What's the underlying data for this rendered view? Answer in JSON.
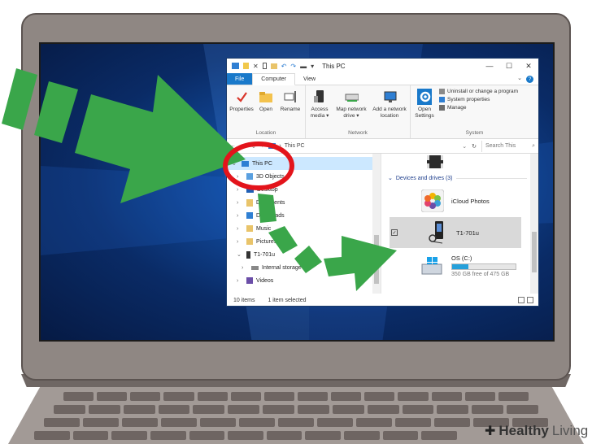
{
  "window": {
    "title": "This PC",
    "tabs": [
      "File",
      "Computer",
      "View"
    ],
    "help_glyph": "?",
    "controls": {
      "minimize": "—",
      "maximize": "☐",
      "close": "✕"
    }
  },
  "ribbon": {
    "location_group": {
      "name": "Location",
      "items": [
        "Properties",
        "Open",
        "Rename"
      ]
    },
    "network_group": {
      "name": "Network",
      "items": [
        {
          "line1": "Access",
          "line2": "media ▾"
        },
        {
          "line1": "Map network",
          "line2": "drive ▾"
        },
        {
          "line1": "Add a network",
          "line2": "location"
        }
      ]
    },
    "system_group": {
      "name": "System",
      "open_settings": {
        "line1": "Open",
        "line2": "Settings"
      },
      "small_items": [
        "Uninstall or change a program",
        "System properties",
        "Manage"
      ]
    }
  },
  "address_bar": {
    "path": "This PC",
    "search_placeholder": "Search This"
  },
  "nav_pane": {
    "items": [
      {
        "label": "This PC",
        "level": 0,
        "expanded": true,
        "selected": true
      },
      {
        "label": "3D Objects",
        "level": 1
      },
      {
        "label": "Desktop",
        "level": 1
      },
      {
        "label": "Documents",
        "level": 1
      },
      {
        "label": "Downloads",
        "level": 1
      },
      {
        "label": "Music",
        "level": 1
      },
      {
        "label": "Pictures",
        "level": 1
      },
      {
        "label": "T1-701u",
        "level": 1,
        "expanded": true
      },
      {
        "label": "Internal storage",
        "level": 2
      },
      {
        "label": "Videos",
        "level": 1
      }
    ]
  },
  "content": {
    "section_header": "Devices and drives (3)",
    "devices": [
      {
        "name": "iCloud Photos",
        "detail": ""
      },
      {
        "name": "T1-701u",
        "detail": "",
        "selected": true
      },
      {
        "name": "OS (C:)",
        "detail": "350 GB free of 475 GB",
        "used_fraction": 0.26
      }
    ]
  },
  "status_bar": {
    "item_count": "10 items",
    "selection": "1 item selected"
  },
  "watermark": {
    "brand_bold": "Healthy",
    "brand_light": "Living"
  },
  "colors": {
    "arrow_green": "#3aa64a",
    "circle_red": "#e3141b",
    "file_tab_blue": "#1979ca",
    "selection_blue": "#cce8ff"
  }
}
